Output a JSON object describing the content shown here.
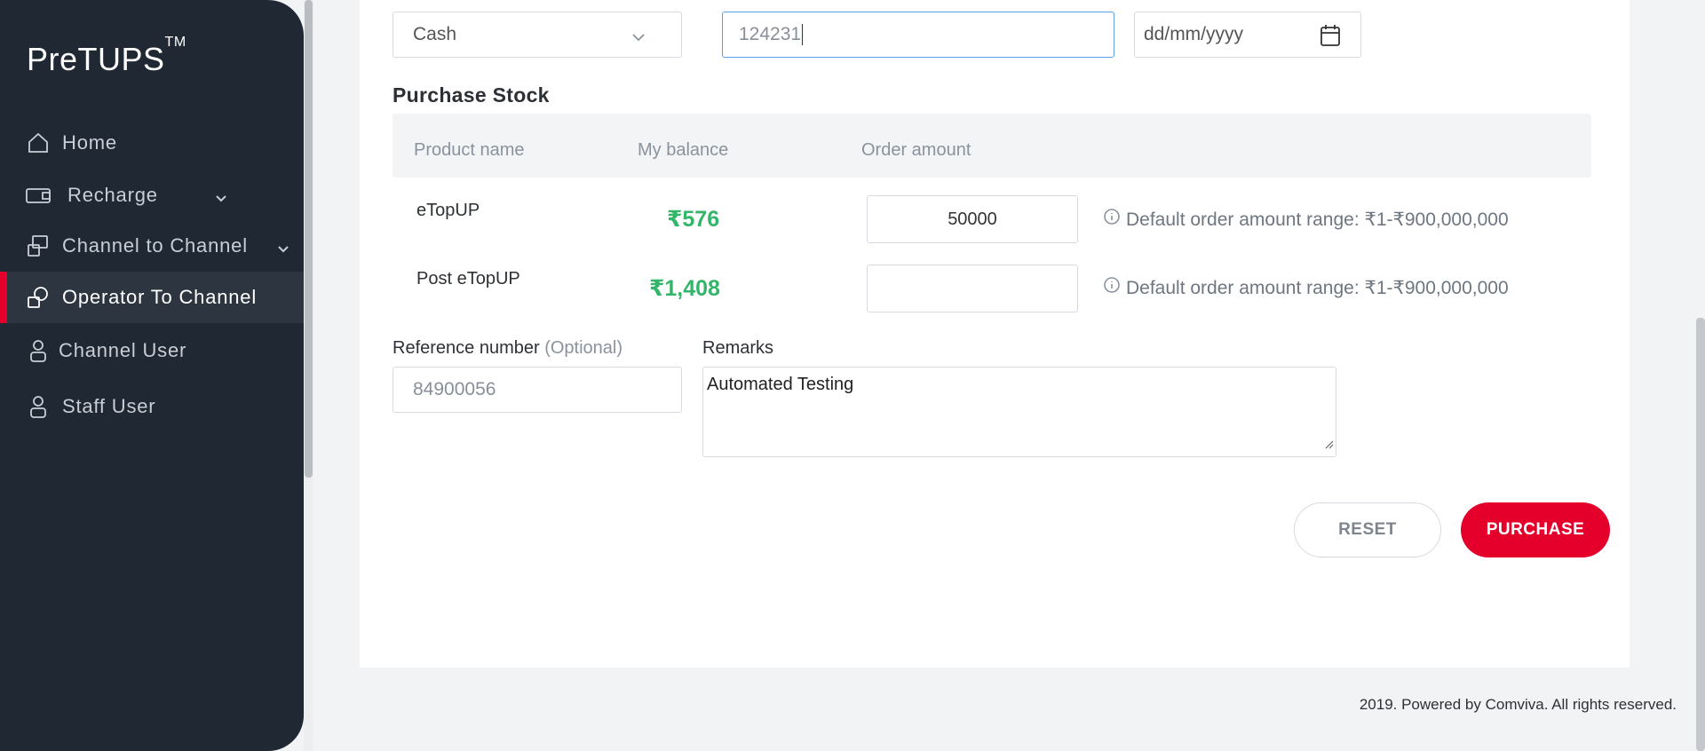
{
  "sidebar": {
    "brand": "PreTUPS",
    "brand_tm": "TM",
    "items": [
      {
        "label": "Home",
        "icon": "home-icon"
      },
      {
        "label": "Recharge",
        "icon": "recharge-icon"
      },
      {
        "label": "Channel to Channel",
        "icon": "channel-transfer-icon"
      },
      {
        "label": "Operator To Channel",
        "icon": "operator-channel-icon",
        "active": true
      },
      {
        "label": "Channel User",
        "icon": "user-icon"
      },
      {
        "label": "Staff User",
        "icon": "user-icon"
      }
    ]
  },
  "form": {
    "payment_type_value": "Cash",
    "payment_instrument_value": "124231",
    "payment_date_placeholder": "dd/mm/yyyy",
    "section_title": "Purchase Stock",
    "table": {
      "headers": [
        "Product name",
        "My balance",
        "Order amount"
      ],
      "rows": [
        {
          "product": "eTopUP",
          "balance": "₹576",
          "order_amount": "50000",
          "hint": "Default order amount range: ₹1-₹900,000,000"
        },
        {
          "product": "Post eTopUP",
          "balance": "₹1,408",
          "order_amount": "",
          "hint": "Default order amount range: ₹1-₹900,000,000"
        }
      ]
    },
    "reference_label": "Reference number",
    "reference_optional": "(Optional)",
    "reference_placeholder": "84900056",
    "remarks_label": "Remarks",
    "remarks_value": "Automated Testing",
    "reset_label": "RESET",
    "purchase_label": "PURCHASE"
  },
  "footer": "2019. Powered by Comviva. All rights reserved.",
  "colors": {
    "sidebar_bg": "#1f2833",
    "accent": "#e4002b",
    "balance_green": "#33b56a",
    "focus_border": "#5aa0e6"
  }
}
